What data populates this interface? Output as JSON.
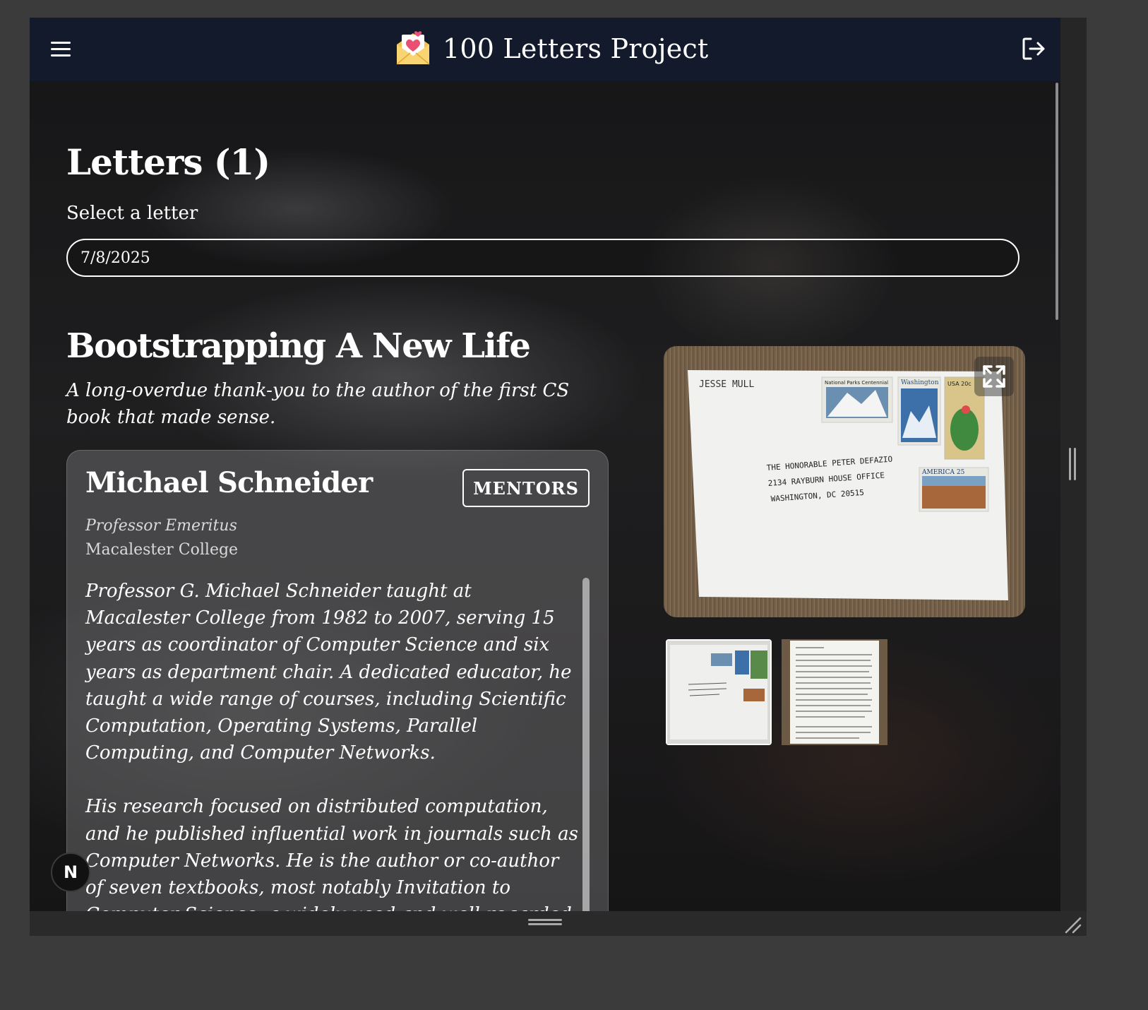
{
  "header": {
    "title": "100 Letters Project",
    "menu_icon": "hamburger-menu-icon",
    "logo_icon": "envelope-heart-icon",
    "logout_icon": "logout-icon",
    "background": "#121a2c"
  },
  "letters": {
    "heading": "Letters (1)",
    "select_label": "Select a letter",
    "selected_value": "7/8/2025"
  },
  "letter": {
    "title": "Bootstrapping A New Life",
    "subtitle": "A long-overdue thank-you to the author of the first CS book that made sense."
  },
  "recipient": {
    "name": "Michael Schneider",
    "category": "MENTORS",
    "role": "Professor Emeritus",
    "organization": "Macalester College",
    "bio": [
      "Professor G. Michael Schneider taught at Macalester College from 1982 to 2007, serving 15 years as coordinator of Computer Science and six years as department chair. A dedicated educator, he taught a wide range of courses, including Scientific Computation, Operating Systems, Parallel Computing, and Computer Networks.",
      "His research focused on distributed computation, and he published influential work in journals such as Computer Networks. He is the author or co-author of seven textbooks, most notably Invitation to Computer Science, a widely used and well-regarded introduction to the field. Known for its clear structure and accessibility, the book has helped"
    ]
  },
  "gallery": {
    "fullscreen_icon": "expand-fullscreen-icon",
    "envelope": {
      "sender": "JESSE MULL",
      "address": [
        "THE HONORABLE PETER DEFAZIO",
        "2134 RAYBURN HOUSE OFFICE",
        "WASHINGTON, DC 20515"
      ],
      "stamps": [
        "National Parks Centennial",
        "Washington",
        "USA 20c",
        "AMERICA 25"
      ]
    }
  },
  "floating_badge": {
    "label": "N"
  },
  "colors": {
    "page_background": "#3b3b3c",
    "card_background": "rgba(150,150,152,0.35)",
    "text": "#ffffff"
  }
}
